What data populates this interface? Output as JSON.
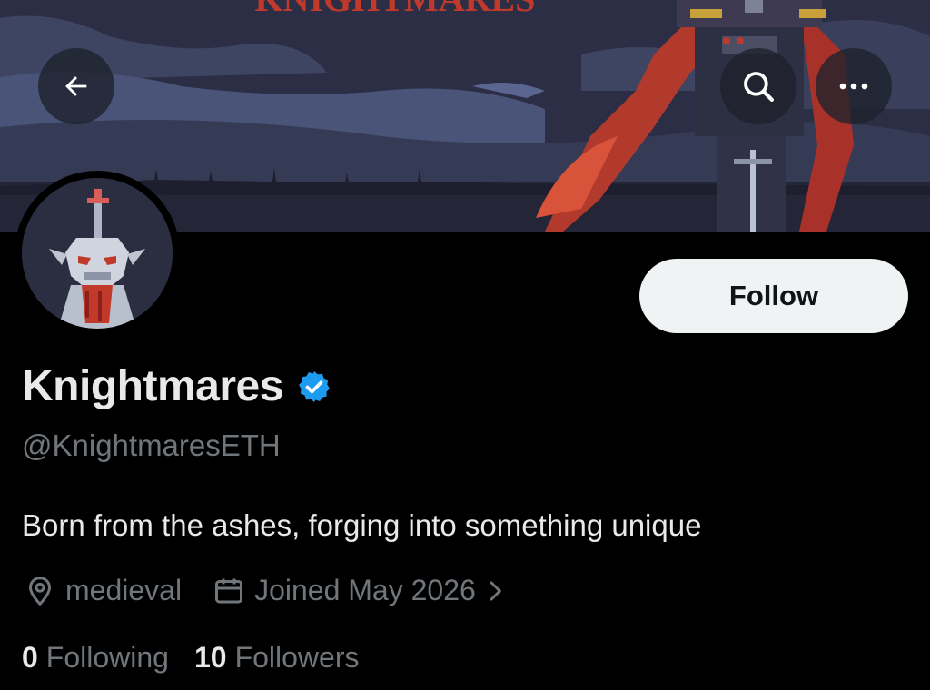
{
  "header": {
    "back_icon": "arrow-left-icon",
    "search_icon": "search-icon",
    "more_icon": "more-horizontal-icon"
  },
  "banner": {
    "title_text": "KNIGHTMARES"
  },
  "profile": {
    "display_name": "Knightmares",
    "verified_badge": "verified-badge-icon",
    "handle": "@KnightmaresETH",
    "bio": "Born from the ashes, forging into something unique",
    "location": "medieval",
    "joined": "Joined May 2026",
    "follow_label": "Follow",
    "following_count": "0",
    "following_label": "Following",
    "followers_count": "10",
    "followers_label": "Followers"
  },
  "colors": {
    "background": "#000000",
    "primary_text": "#e7e9ea",
    "secondary_text": "#71767b",
    "verified_blue": "#1d9bf0",
    "follow_button_bg": "#eff3f4",
    "banner_red": "#c0392b"
  }
}
